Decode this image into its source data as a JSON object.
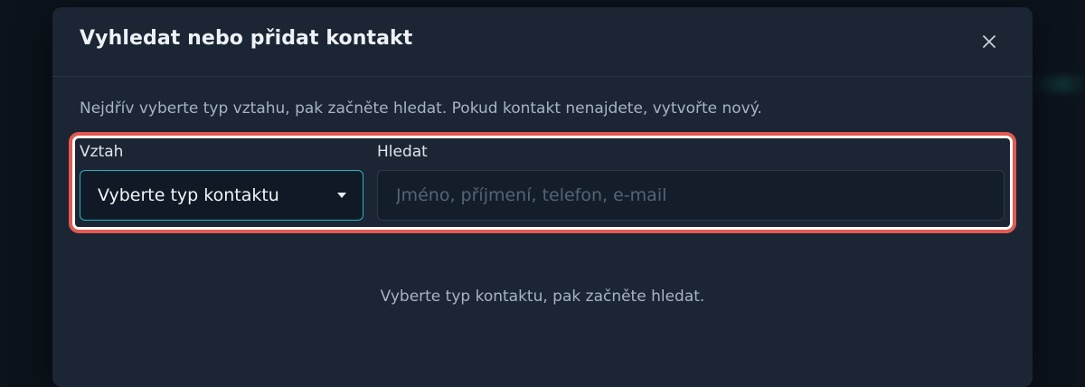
{
  "dialog": {
    "title": "Vyhledat nebo přidat kontakt",
    "close_icon": "close-icon",
    "intro": "Nejdřív vyberte typ vztahu, pak začněte hledat. Pokud kontakt nenajdete, vytvořte nový."
  },
  "relation": {
    "label": "Vztah",
    "selected": "Vyberte typ kontaktu",
    "caret_icon": "caret-down-icon"
  },
  "search": {
    "label": "Hledat",
    "value": "",
    "placeholder": "Jméno, příjmení, telefon, e-mail"
  },
  "empty_state": {
    "message": "Vyberte typ kontaktu, pak začněte hledat."
  },
  "colors": {
    "accent": "#2ab2c4",
    "highlight_outer": "#e25a52",
    "highlight_inner": "#ffffff",
    "dialog_bg": "#1b2534",
    "page_bg": "#0c131b"
  }
}
